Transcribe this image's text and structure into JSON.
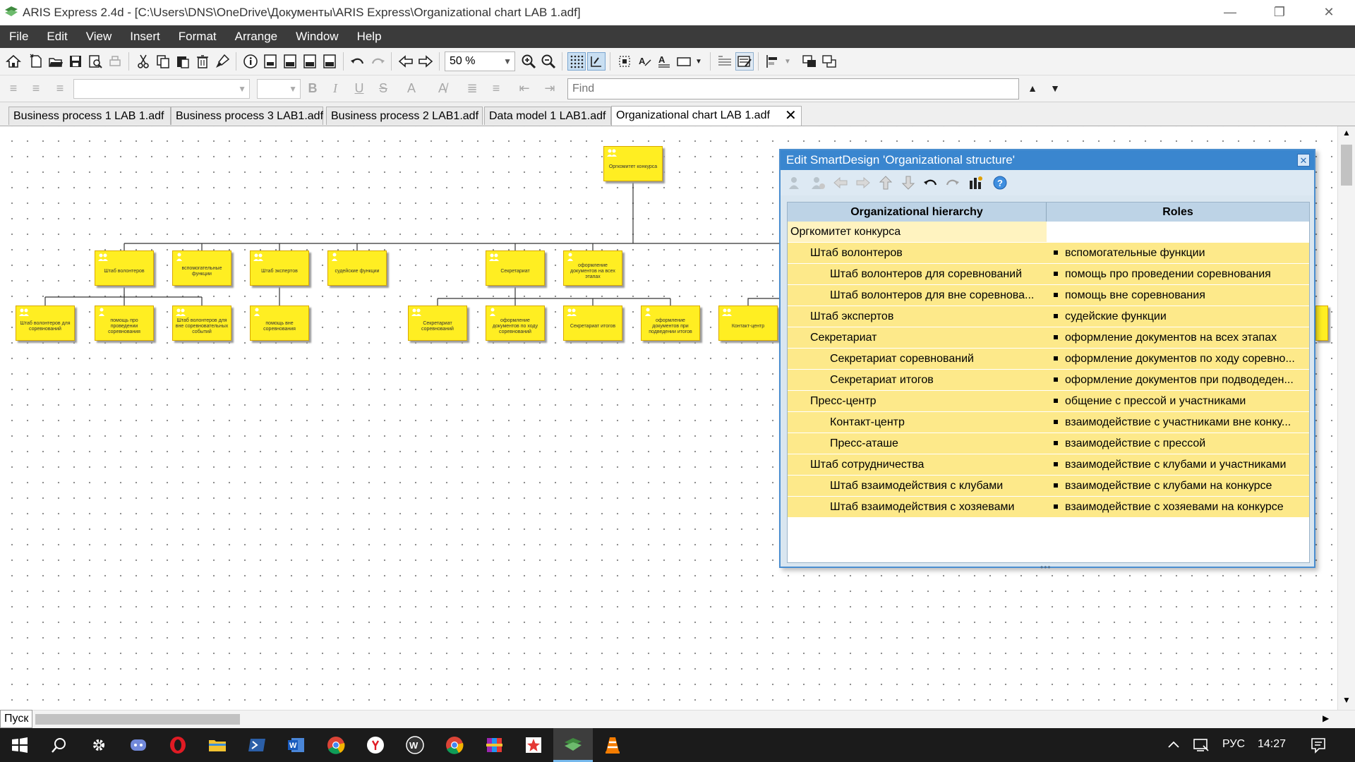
{
  "window": {
    "title": "ARIS Express 2.4d - [C:\\Users\\DNS\\OneDrive\\Документы\\ARIS Express\\Organizational chart LAB 1.adf]"
  },
  "menu": [
    "File",
    "Edit",
    "View",
    "Insert",
    "Format",
    "Arrange",
    "Window",
    "Help"
  ],
  "toolbar": {
    "zoom_value": "50 %",
    "find_placeholder": "Find"
  },
  "tabs": [
    {
      "label": "Business process 1 LAB 1.adf"
    },
    {
      "label": "Business process 3 LAB1.adf"
    },
    {
      "label": "Business process 2 LAB1.adf"
    },
    {
      "label": "Data model 1 LAB1.adf"
    },
    {
      "label": "Organizational chart LAB 1.adf",
      "active": true
    }
  ],
  "chart_boxes": {
    "top": "Оргкомитет конкурса",
    "l1": [
      "Штаб волонтеров",
      "вспомогательные функции",
      "Штаб экспертов",
      "судейские функции",
      "Секретариат",
      "оформление документов на всех этапах"
    ],
    "l2": [
      "Штаб волонтеров для соревнований",
      "помощь про проведении соревнования",
      "Штаб волонтеров для вне соревновательных событий",
      "помощь вне соревнования",
      "Секретариат соревнований",
      "оформление документов по ходу соревнований",
      "Секретариат итогов",
      "оформление документов при подведении итогов",
      "Контакт-центр"
    ]
  },
  "panel": {
    "title": "Edit SmartDesign 'Organizational structure'",
    "col_hierarchy": "Organizational hierarchy",
    "col_roles": "Roles",
    "rows": [
      {
        "name": "Оргкомитет конкурса",
        "role": "",
        "level": 0
      },
      {
        "name": "Штаб волонтеров",
        "role": "вспомогательные функции",
        "level": 1
      },
      {
        "name": "Штаб волонтеров для соревнований",
        "role": "помощь про проведении соревнования",
        "level": 2
      },
      {
        "name": "Штаб волонтеров для вне соревнова...",
        "role": "помощь вне соревнования",
        "level": 2
      },
      {
        "name": "Штаб экспертов",
        "role": "судейские функции",
        "level": 1
      },
      {
        "name": "Секретариат",
        "role": "оформление документов на всех этапах",
        "level": 1
      },
      {
        "name": "Секретариат соревнований",
        "role": "оформление документов по ходу соревно...",
        "level": 2
      },
      {
        "name": "Секретариат итогов",
        "role": "оформление документов при подводеден...",
        "level": 2
      },
      {
        "name": "Пресс-центр",
        "role": "общение с прессой и участниками",
        "level": 1
      },
      {
        "name": "Контакт-центр",
        "role": "взаимодействие с участниками вне конку...",
        "level": 2
      },
      {
        "name": "Пресс-аташе",
        "role": "взаимодействие с прессой",
        "level": 2
      },
      {
        "name": "Штаб сотрудничества",
        "role": "взаимодействие с клубами и участниками",
        "level": 1
      },
      {
        "name": "Штаб взаимодействия с клубами",
        "role": "взаимодействие с клубами на конкурсе",
        "level": 2
      },
      {
        "name": "Штаб взаимодействия с хозяевами",
        "role": "взаимодействие с хозяевами на конкурсе",
        "level": 2
      }
    ]
  },
  "taskbar": {
    "start_tooltip": "Пуск",
    "language": "РУС",
    "clock": "14:27"
  }
}
